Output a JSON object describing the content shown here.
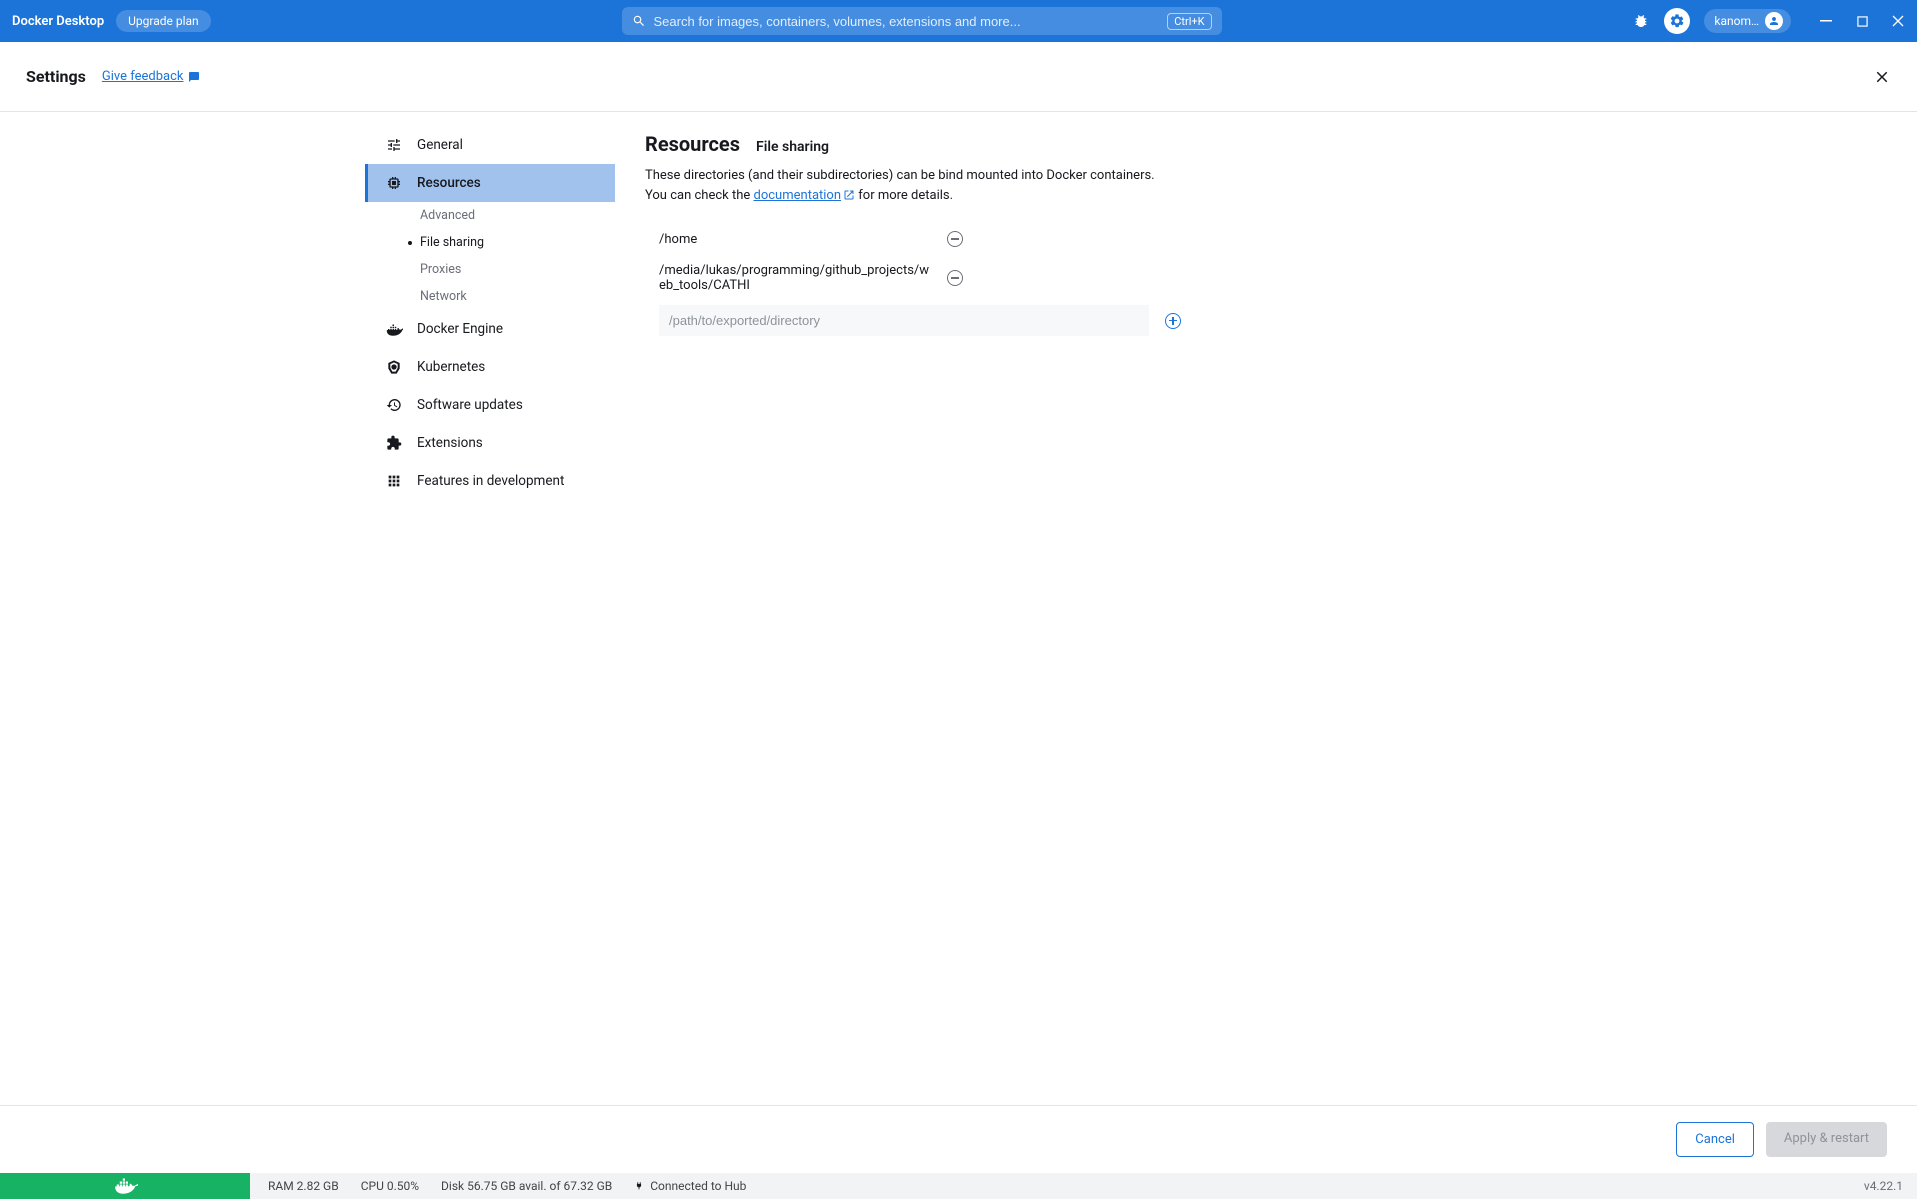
{
  "titlebar": {
    "app_name": "Docker Desktop",
    "upgrade_label": "Upgrade plan",
    "search_placeholder": "Search for images, containers, volumes, extensions and more...",
    "shortcut": "Ctrl+K",
    "account_name": "kanom…"
  },
  "settings_header": {
    "title": "Settings",
    "feedback": "Give feedback"
  },
  "sidebar": {
    "items": [
      {
        "label": "General"
      },
      {
        "label": "Resources"
      },
      {
        "label": "Docker Engine"
      },
      {
        "label": "Kubernetes"
      },
      {
        "label": "Software updates"
      },
      {
        "label": "Extensions"
      },
      {
        "label": "Features in development"
      }
    ],
    "sub_items": [
      {
        "label": "Advanced"
      },
      {
        "label": "File sharing"
      },
      {
        "label": "Proxies"
      },
      {
        "label": "Network"
      }
    ]
  },
  "content": {
    "heading": "Resources",
    "subheading": "File sharing",
    "desc_pre": "These directories (and their subdirectories) can be bind mounted into Docker containers. You can check the ",
    "desc_link": "documentation",
    "desc_post": " for more details.",
    "paths": [
      "/home",
      "/media/lukas/programming/github_projects/web_tools/CATHI"
    ],
    "add_placeholder": "/path/to/exported/directory"
  },
  "footer": {
    "cancel": "Cancel",
    "apply": "Apply & restart"
  },
  "statusbar": {
    "ram": "RAM 2.82 GB",
    "cpu": "CPU 0.50%",
    "disk": "Disk 56.75 GB avail. of 67.32 GB",
    "hub": "Connected to Hub",
    "version": "v4.22.1"
  }
}
